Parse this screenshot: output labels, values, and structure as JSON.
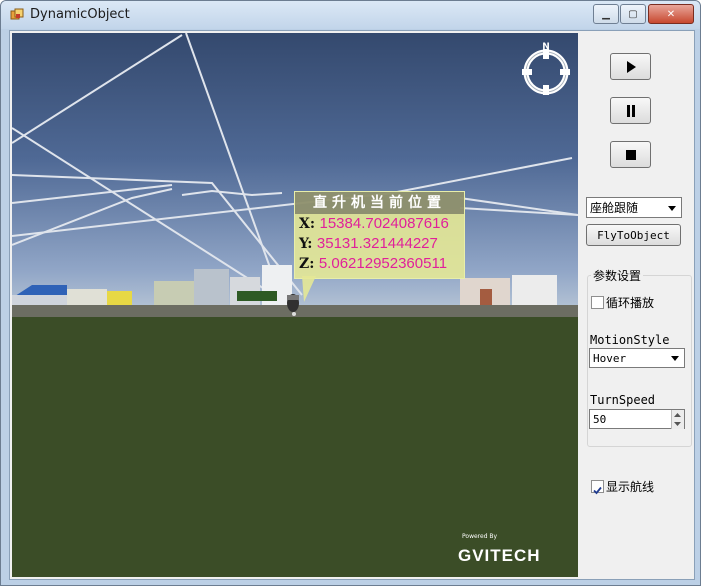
{
  "window": {
    "title": "DynamicObject"
  },
  "viewport": {
    "position_label": {
      "header": "直升机当前位置",
      "x_key": "X:",
      "x_value": "15384.7024087616",
      "y_key": "Y:",
      "y_value": "35131.321444227",
      "z_key": "Z:",
      "z_value": "5.06212952360511"
    },
    "compass_letter": "N",
    "brand": {
      "powered_by": "Powered By",
      "logo": "GVITECH"
    }
  },
  "controls": {
    "play_icon": "play-icon",
    "pause_icon": "pause-icon",
    "stop_icon": "stop-icon",
    "view_mode": "座舱跟随",
    "fly_to_object": "FlyToObject",
    "params_group_title": "参数设置",
    "loop_play_label": "循环播放",
    "loop_play_checked": false,
    "motion_style_label": "MotionStyle",
    "motion_style_value": "Hover",
    "turn_speed_label": "TurnSpeed",
    "turn_speed_value": "50",
    "show_route_label": "显示航线",
    "show_route_checked": true
  }
}
